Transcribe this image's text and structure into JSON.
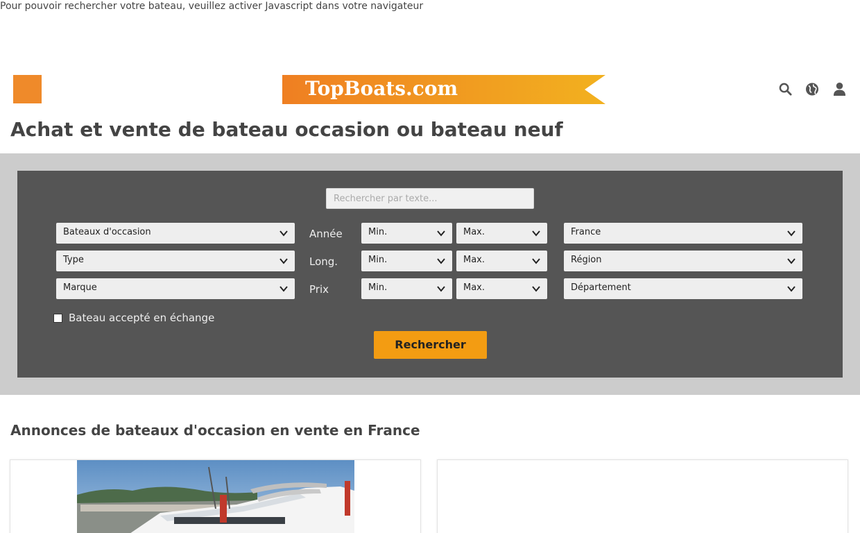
{
  "noscript_message": "Pour pouvoir rechercher votre bateau, veuillez activer Javascript dans votre navigateur",
  "header": {
    "logo_text": "TopBoats.com",
    "menu_icon": "menu-square-icon",
    "icons": [
      "search-icon",
      "globe-icon",
      "user-icon"
    ]
  },
  "page_title": "Achat et vente de bateau occasion ou bateau neuf",
  "search": {
    "text_placeholder": "Rechercher par texte...",
    "category_select": "Bateaux d'occasion",
    "type_select": "Type",
    "brand_select": "Marque",
    "year_label": "Année",
    "length_label": "Long.",
    "price_label": "Prix",
    "min_label": "Min.",
    "max_label": "Max.",
    "country_select": "France",
    "region_select": "Région",
    "department_select": "Département",
    "exchange_label": "Bateau accepté en échange",
    "submit_label": "Rechercher"
  },
  "listings": {
    "section_title": "Annonces de bateaux d'occasion en vente en France"
  },
  "colors": {
    "accent": "#f39c12",
    "menu_orange": "#ef8a2a",
    "panel_dark": "#555555",
    "band_gray": "#cccccc"
  }
}
